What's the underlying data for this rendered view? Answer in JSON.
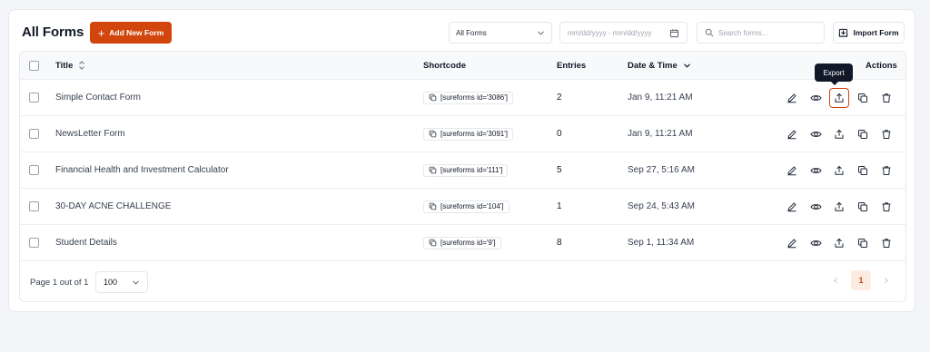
{
  "page": {
    "title": "All Forms"
  },
  "toolbar": {
    "add_label": "Add New Form",
    "filter_selected": "All Forms",
    "date_placeholder": "mm/dd/yyyy - mm/dd/yyyy",
    "search_placeholder": "Search forms...",
    "import_label": "Import Form"
  },
  "table": {
    "headers": {
      "title": "Title",
      "shortcode": "Shortcode",
      "entries": "Entries",
      "date": "Date & Time",
      "actions": "Actions"
    },
    "rows": [
      {
        "title": "Simple Contact Form",
        "shortcode": "[sureforms id='3086']",
        "entries": "2",
        "date": "Jan 9, 11:21 AM"
      },
      {
        "title": "NewsLetter Form",
        "shortcode": "[sureforms id='3091']",
        "entries": "0",
        "date": "Jan 9, 11:21 AM"
      },
      {
        "title": "Financial Health and Investment Calculator",
        "shortcode": "[sureforms id='111']",
        "entries": "5",
        "date": "Sep 27, 5:16 AM"
      },
      {
        "title": "30-DAY ACNE CHALLENGE",
        "shortcode": "[sureforms id='104']",
        "entries": "1",
        "date": "Sep 24, 5:43 AM"
      },
      {
        "title": "Student Details",
        "shortcode": "[sureforms id='9']",
        "entries": "8",
        "date": "Sep 1, 11:34 AM"
      }
    ]
  },
  "tooltip": {
    "text": "Export"
  },
  "footer": {
    "page_info": "Page 1 out of 1",
    "per_page": "100",
    "current_page": "1"
  },
  "colors": {
    "accent": "#d2450d",
    "accent_light": "#fdebe2",
    "text": "#111827"
  }
}
